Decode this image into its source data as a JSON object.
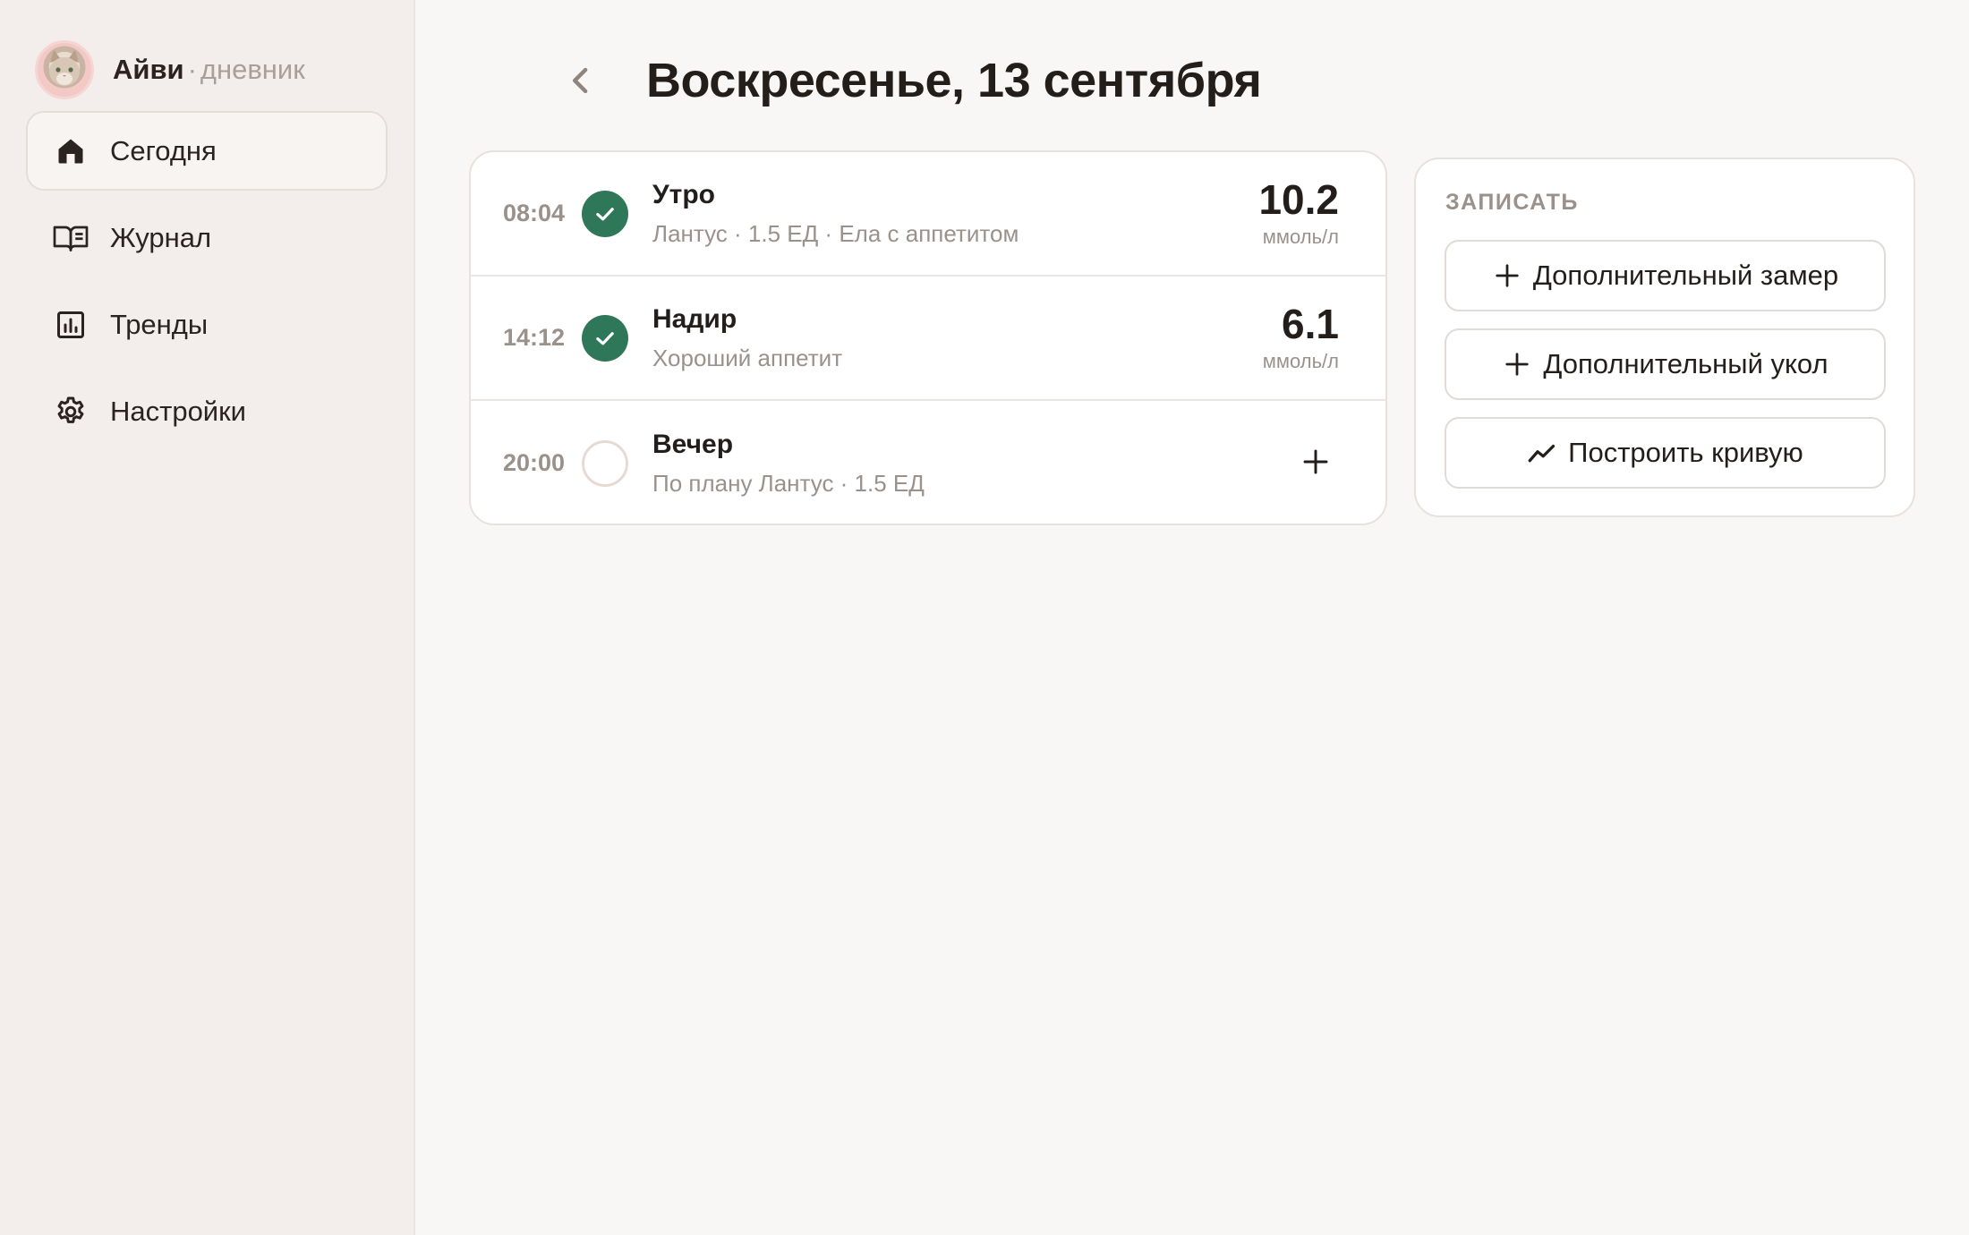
{
  "brand": {
    "name": "Айви",
    "separator": "·",
    "subtitle": "дневник"
  },
  "sidebar": {
    "items": [
      {
        "label": "Сегодня",
        "icon": "home-icon",
        "active": true
      },
      {
        "label": "Журнал",
        "icon": "book-icon",
        "active": false
      },
      {
        "label": "Тренды",
        "icon": "chart-icon",
        "active": false
      },
      {
        "label": "Настройки",
        "icon": "gear-icon",
        "active": false
      }
    ]
  },
  "header": {
    "title": "Воскресенье, 13 сентября"
  },
  "entries": [
    {
      "time": "08:04",
      "title": "Утро",
      "subtitle": "Лантус · 1.5 ЕД · Ела с аппетитом",
      "value": "10.2",
      "unit": "ммоль/л",
      "status": "done"
    },
    {
      "time": "14:12",
      "title": "Надир",
      "subtitle": "Хороший аппетит",
      "value": "6.1",
      "unit": "ммоль/л",
      "status": "done"
    },
    {
      "time": "20:00",
      "title": "Вечер",
      "subtitle": "По плану Лантус · 1.5 ЕД",
      "status": "pending"
    }
  ],
  "record": {
    "title": "ЗАПИСАТЬ",
    "buttons": [
      {
        "label": "Дополнительный замер",
        "icon": "plus-icon"
      },
      {
        "label": "Дополнительный укол",
        "icon": "plus-icon"
      },
      {
        "label": "Построить кривую",
        "icon": "trend-icon"
      }
    ]
  },
  "colors": {
    "accent_green": "#2e7758",
    "sidebar_bg": "#f3eeeb",
    "page_bg": "#f9f7f5",
    "muted_text": "#9b918b"
  }
}
